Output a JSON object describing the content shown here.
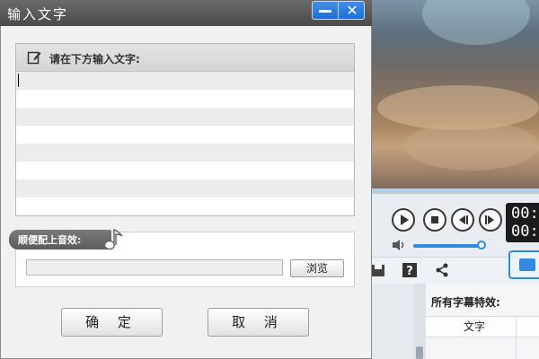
{
  "dialog": {
    "title": "输入文字",
    "minimize_icon": "minimize-icon",
    "close_icon": "close-icon",
    "close_glyph": "✕",
    "text_section": {
      "header": "请在下方输入文字:",
      "icon": "edit-icon",
      "value": ""
    },
    "music_section": {
      "label": "顺便配上音效:",
      "icon": "music-note-icon",
      "file_value": "",
      "browse_label": "浏览"
    },
    "ok_label": "确 定",
    "cancel_label": "取 消"
  },
  "background": {
    "player": {
      "time_top": "00:",
      "time_bottom": "00:",
      "volume_level": 0.95
    },
    "effects_panel": {
      "title": "所有字幕特效:",
      "column_header": "文字"
    },
    "colors": {
      "accent": "#2f8ae0",
      "titlebar": "#4f4f4f"
    }
  }
}
